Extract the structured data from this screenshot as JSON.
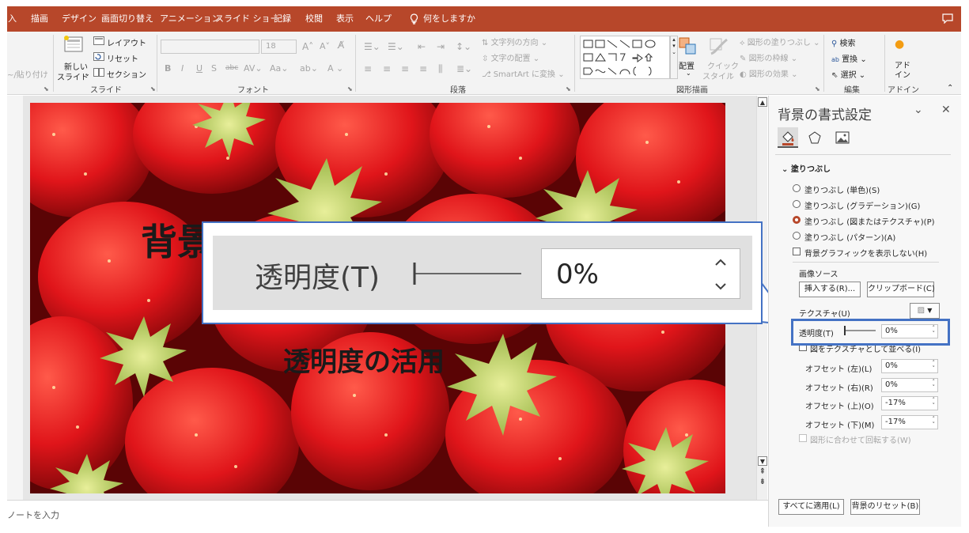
{
  "tabs": [
    "入",
    "描画",
    "デザイン",
    "画面切り替え",
    "アニメーション",
    "スライド ショー",
    "記録",
    "校閲",
    "表示",
    "ヘルプ"
  ],
  "tell_me": "何をしますか",
  "ribbon": {
    "paste_label": "~/貼り付け",
    "slide_group": {
      "new_slide": "新しい",
      "new_slide2": "スライド",
      "layout": "レイアウト",
      "reset": "リセット",
      "section": "セクション",
      "label": "スライド"
    },
    "font_group": {
      "size": "18",
      "label": "フォント"
    },
    "paragraph_group": {
      "text_direction": "文字列の方向",
      "align_text": "文字の配置",
      "smartart": "SmartArt に変換",
      "label": "段落"
    },
    "drawing_group": {
      "arrange": "配置",
      "quick_style": "クイック",
      "quick_style2": "スタイル",
      "shape_fill": "図形の塗りつぶし",
      "shape_outline": "図形の枠線",
      "shape_effect": "図形の効果",
      "label": "図形描画"
    },
    "edit_group": {
      "find": "検索",
      "replace": "置換",
      "select": "選択",
      "label": "編集"
    },
    "addin_group": {
      "addin": "アド",
      "addin2": "イン",
      "label": "アドイン"
    }
  },
  "slide": {
    "title": "背景",
    "subtitle": "透明度の活用"
  },
  "callout": {
    "label": "透明度(T)",
    "value": "0%"
  },
  "notes_placeholder": "ノートを入力",
  "pane": {
    "title": "背景の書式設定",
    "section": "塗りつぶし",
    "fill_options": [
      "塗りつぶし (単色)(S)",
      "塗りつぶし (グラデーション)(G)",
      "塗りつぶし (図またはテクスチャ)(P)",
      "塗りつぶし (パターン)(A)"
    ],
    "selected_fill": 2,
    "hide_graphics": "背景グラフィックを表示しない(H)",
    "image_source": "画像ソース",
    "insert_btn": "挿入する(R)...",
    "clipboard_btn": "クリップボード(C)",
    "texture": "テクスチャ(U)",
    "transparency_label": "透明度(T)",
    "transparency_value": "0%",
    "tile": "図をテクスチャとして並べる(I)",
    "offsets": [
      {
        "label": "オフセット (左)(L)",
        "value": "0%"
      },
      {
        "label": "オフセット (右)(R)",
        "value": "0%"
      },
      {
        "label": "オフセット (上)(O)",
        "value": "-17%"
      },
      {
        "label": "オフセット (下)(M)",
        "value": "-17%"
      }
    ],
    "rotate_with_shape": "図形に合わせて回転する(W)",
    "apply_all": "すべてに適用(L)",
    "reset_bg": "背景のリセット(B)"
  },
  "colors": {
    "accent": "#b7472a",
    "callout_border": "#4472c4"
  }
}
